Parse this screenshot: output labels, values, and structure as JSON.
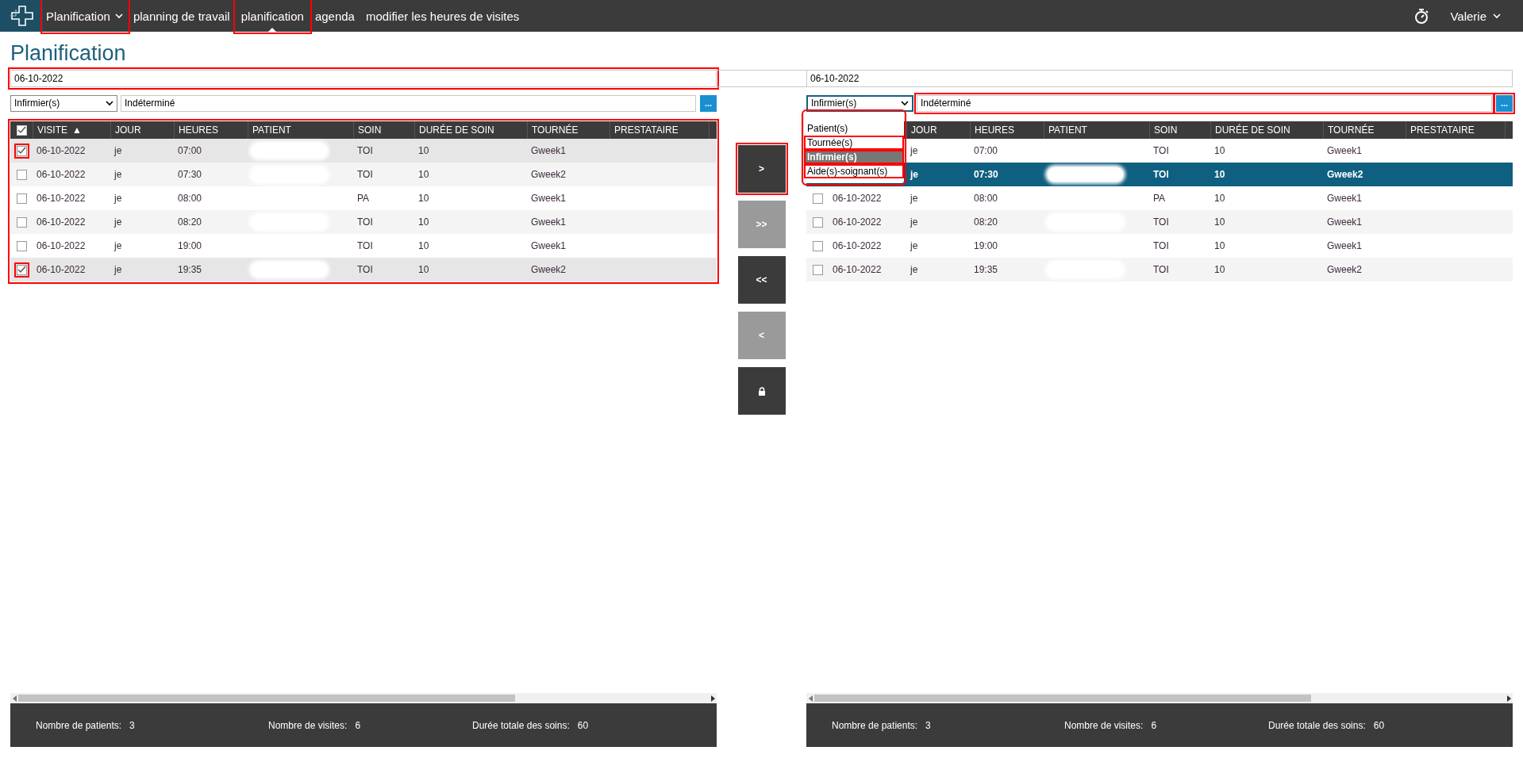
{
  "nav": {
    "brand_menu": "Planification",
    "links": [
      {
        "label": "planning de travail",
        "selected": false
      },
      {
        "label": "planification",
        "selected": true
      },
      {
        "label": "agenda",
        "selected": false
      },
      {
        "label": "modifier les heures de visites",
        "selected": false
      }
    ],
    "user": "Valerie"
  },
  "page_title": "Planification",
  "panels": [
    {
      "date": "06-10-2022",
      "filter": {
        "selected_option": "Infirmier(s)",
        "value": "Indéterminé",
        "button": "..."
      },
      "header_checked": true,
      "columns": [
        {
          "label": "VISITE",
          "sort": "▲"
        },
        {
          "label": "JOUR"
        },
        {
          "label": "HEURES"
        },
        {
          "label": "PATIENT"
        },
        {
          "label": "SOIN"
        },
        {
          "label": "DURÉE DE SOIN"
        },
        {
          "label": "TOURNÉE"
        },
        {
          "label": "PRESTATAIRE"
        }
      ],
      "rows": [
        {
          "checked": true,
          "selected": false,
          "visite": "06-10-2022",
          "jour": "je",
          "heures": "07:00",
          "patient_redacted": true,
          "soin": "TOI",
          "duree": "10",
          "tournee": "Gweek1"
        },
        {
          "checked": false,
          "selected": false,
          "visite": "06-10-2022",
          "jour": "je",
          "heures": "07:30",
          "patient_redacted": true,
          "soin": "TOI",
          "duree": "10",
          "tournee": "Gweek2"
        },
        {
          "checked": false,
          "selected": false,
          "visite": "06-10-2022",
          "jour": "je",
          "heures": "08:00",
          "patient_redacted": false,
          "soin": "PA",
          "duree": "10",
          "tournee": "Gweek1"
        },
        {
          "checked": false,
          "selected": false,
          "visite": "06-10-2022",
          "jour": "je",
          "heures": "08:20",
          "patient_redacted": true,
          "soin": "TOI",
          "duree": "10",
          "tournee": "Gweek1"
        },
        {
          "checked": false,
          "selected": false,
          "visite": "06-10-2022",
          "jour": "je",
          "heures": "19:00",
          "patient_redacted": false,
          "soin": "TOI",
          "duree": "10",
          "tournee": "Gweek1"
        },
        {
          "checked": true,
          "selected": false,
          "visite": "06-10-2022",
          "jour": "je",
          "heures": "19:35",
          "patient_redacted": true,
          "soin": "TOI",
          "duree": "10",
          "tournee": "Gweek2"
        }
      ],
      "footer": [
        {
          "label": "Nombre de patients:",
          "value": "3"
        },
        {
          "label": "Nombre de visites:",
          "value": "6"
        },
        {
          "label": "Durée totale des soins:",
          "value": "60"
        }
      ]
    },
    {
      "date": "06-10-2022",
      "filter": {
        "selected_option": "Infirmier(s)",
        "value": "Indéterminé",
        "button": "..."
      },
      "dropdown": {
        "options": [
          {
            "label": "Patient(s)",
            "selected": false
          },
          {
            "label": "Tournée(s)",
            "selected": false
          },
          {
            "label": "Infirmier(s)",
            "selected": true
          },
          {
            "label": "Aide(s)-soignant(s)",
            "selected": false
          }
        ]
      },
      "columns": [
        {
          "label": "JOUR"
        },
        {
          "label": "HEURES"
        },
        {
          "label": "PATIENT"
        },
        {
          "label": "SOIN"
        },
        {
          "label": "DURÉE DE SOIN"
        },
        {
          "label": "TOURNÉE"
        },
        {
          "label": "PRESTATAIRE"
        }
      ],
      "rows": [
        {
          "selected": false,
          "jour": "je",
          "heures": "07:00",
          "patient_redacted": false,
          "soin": "TOI",
          "duree": "10",
          "tournee": "Gweek1"
        },
        {
          "selected": true,
          "jour": "je",
          "heures": "07:30",
          "patient_redacted": true,
          "soin": "TOI",
          "duree": "10",
          "tournee": "Gweek2"
        },
        {
          "checked": false,
          "selected": false,
          "visite": "06-10-2022",
          "jour": "je",
          "heures": "08:00",
          "patient_redacted": false,
          "soin": "PA",
          "duree": "10",
          "tournee": "Gweek1"
        },
        {
          "checked": false,
          "selected": false,
          "visite": "06-10-2022",
          "jour": "je",
          "heures": "08:20",
          "patient_redacted": true,
          "soin": "TOI",
          "duree": "10",
          "tournee": "Gweek1"
        },
        {
          "checked": false,
          "selected": false,
          "visite": "06-10-2022",
          "jour": "je",
          "heures": "19:00",
          "patient_redacted": false,
          "soin": "TOI",
          "duree": "10",
          "tournee": "Gweek1"
        },
        {
          "checked": false,
          "selected": false,
          "visite": "06-10-2022",
          "jour": "je",
          "heures": "19:35",
          "patient_redacted": true,
          "soin": "TOI",
          "duree": "10",
          "tournee": "Gweek2"
        }
      ],
      "footer": [
        {
          "label": "Nombre de patients:",
          "value": "3"
        },
        {
          "label": "Nombre de visites:",
          "value": "6"
        },
        {
          "label": "Durée totale des soins:",
          "value": "60"
        }
      ]
    }
  ],
  "transfer_buttons": [
    {
      "kind": "text",
      "label": ">",
      "disabled": false
    },
    {
      "kind": "text",
      "label": ">>",
      "disabled": true
    },
    {
      "kind": "text",
      "label": "<<",
      "disabled": false
    },
    {
      "kind": "text",
      "label": "<",
      "disabled": true
    },
    {
      "kind": "lock",
      "disabled": false
    }
  ]
}
